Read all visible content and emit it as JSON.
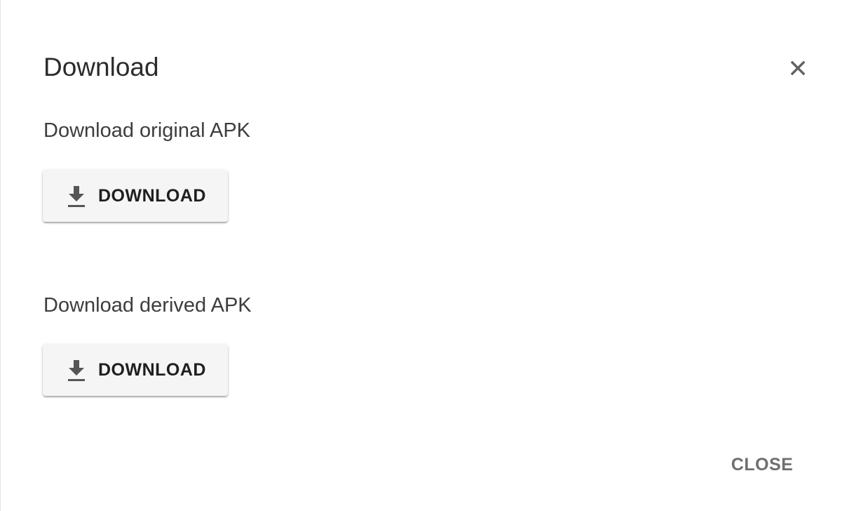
{
  "dialog": {
    "title": "Download",
    "close_icon": "close-icon"
  },
  "sections": [
    {
      "label": "Download original APK",
      "button_label": "DOWNLOAD",
      "button_icon": "download-icon"
    },
    {
      "label": "Download derived APK",
      "button_label": "DOWNLOAD",
      "button_icon": "download-icon"
    }
  ],
  "footer": {
    "close_label": "CLOSE"
  },
  "colors": {
    "button_background": "#f5f5f5",
    "title_text": "#2b2b2b",
    "close_text": "#6f6f6f",
    "icon": "#555555"
  }
}
